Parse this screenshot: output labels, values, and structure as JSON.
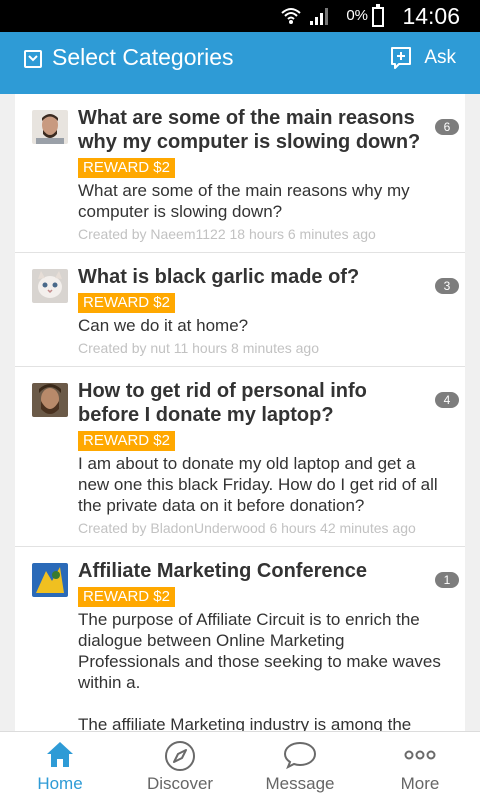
{
  "status_bar": {
    "battery": "0%",
    "time": "14:06"
  },
  "header": {
    "title": "Select Categories",
    "ask_label": "Ask"
  },
  "questions": [
    {
      "title": "What are some of the main reasons why my computer is slowing down?",
      "reward": "REWARD $2",
      "body": "What are some of the main reasons why my computer is slowing down?",
      "meta": "Created by Naeem1122 18 hours 6 minutes ago",
      "count": "6"
    },
    {
      "title": "What is black garlic made of?",
      "reward": "REWARD $2",
      "body": "Can we do it at home?",
      "meta": "Created by nut 11 hours 8 minutes ago",
      "count": "3"
    },
    {
      "title": "How to get rid of personal info before I donate my laptop?",
      "reward": "REWARD $2",
      "body": "I am about to donate my old laptop and get a new one this black Friday. How do I get rid of all the private data on it before donation?",
      "meta": "Created by BladonUnderwood 6 hours 42 minutes ago",
      "count": "4"
    },
    {
      "title": "Affiliate Marketing Conference",
      "reward": "REWARD $2",
      "body": "The purpose of Affiliate Circuit is to enrich the dialogue between Online Marketing Professionals and those seeking to make waves within a.\n\nThe affiliate Marketing industry is among the best in the planet. Do you have all of the",
      "meta": "",
      "count": "1"
    }
  ],
  "bottom_nav": [
    {
      "label": "Home",
      "icon": "home-icon",
      "active": true
    },
    {
      "label": "Discover",
      "icon": "compass-icon",
      "active": false
    },
    {
      "label": "Message",
      "icon": "chat-bubble-icon",
      "active": false
    },
    {
      "label": "More",
      "icon": "more-dots-icon",
      "active": false
    }
  ],
  "colors": {
    "accent": "#2e9bd6",
    "reward": "#ffa800",
    "count_badge": "#7d7d7d"
  }
}
